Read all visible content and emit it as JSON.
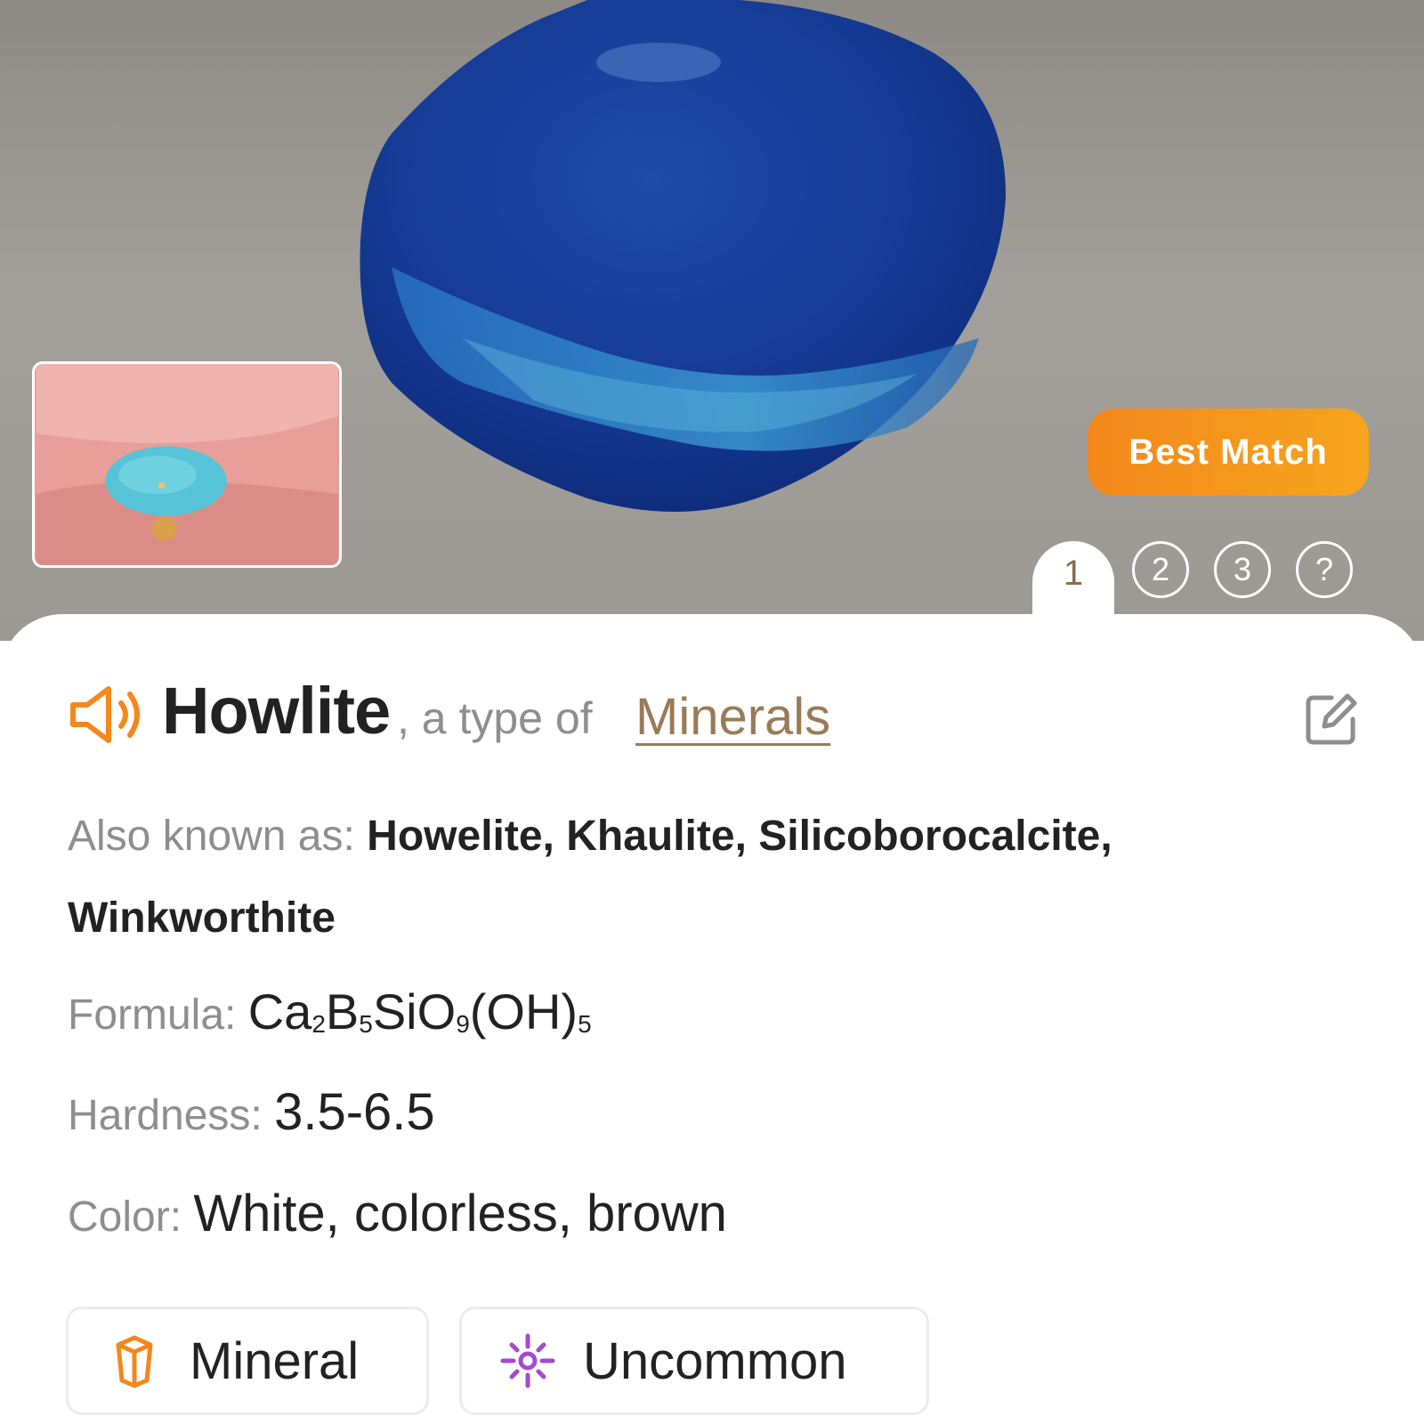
{
  "hero": {
    "badge": "Best Match",
    "tabs": [
      "1",
      "2",
      "3",
      "?"
    ]
  },
  "result": {
    "name": "Howlite",
    "type_prefix": ", a type of ",
    "category_link": "Minerals"
  },
  "details": {
    "aka_label": "Also known as: ",
    "aka_line1": "Howelite, Khaulite, Silicoborocalcite,",
    "aka_line2": "Winkworthite",
    "formula_label": "Formula: ",
    "formula_parts": [
      "Ca",
      "2",
      "B",
      "5",
      "SiO",
      "9",
      "(OH)",
      "5"
    ],
    "hardness_label": "Hardness: ",
    "hardness_value": "3.5-6.5",
    "color_label": "Color: ",
    "color_value": "White, colorless, brown"
  },
  "chips": {
    "mineral": "Mineral",
    "rarity": "Uncommon"
  },
  "colors": {
    "accent_orange": "#f4881c",
    "link_brown": "#9a7b57",
    "rarity_purple": "#a24bd0"
  },
  "icons": [
    "speaker-icon",
    "edit-icon",
    "crystal-icon",
    "sparkle-icon"
  ]
}
